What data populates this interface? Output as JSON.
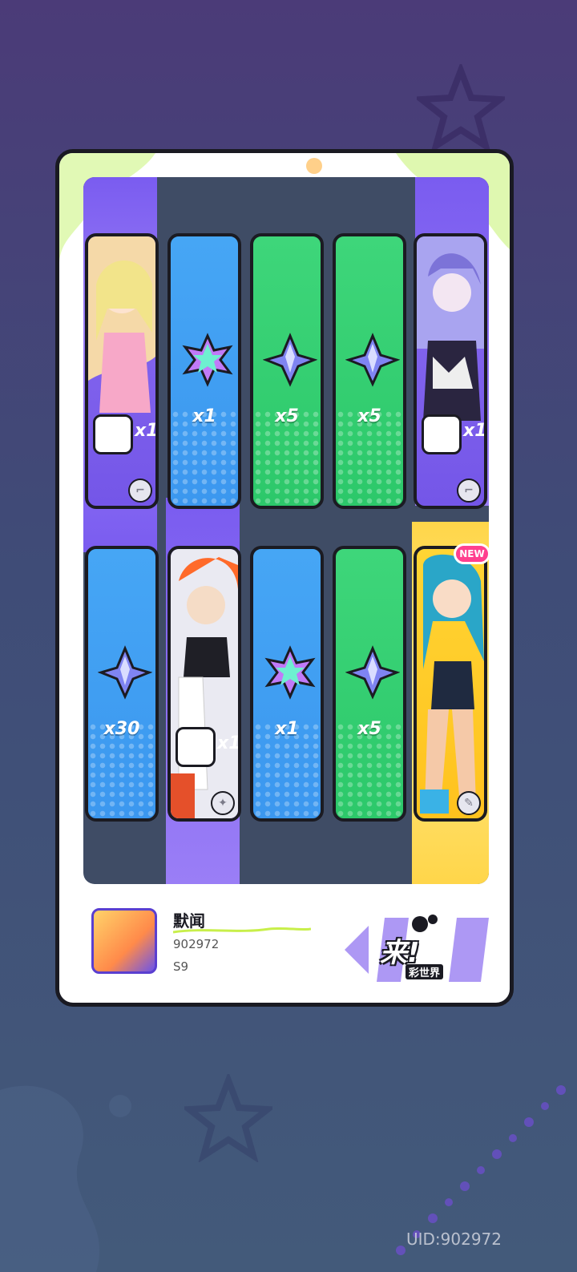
{
  "board": {
    "row1": [
      {
        "kind": "character",
        "color": "purple",
        "badge_label": "x1",
        "type_icon": "gun-icon"
      },
      {
        "kind": "item",
        "color": "blue",
        "gem": "rainbow-leaf-gem-icon",
        "qty": "x1"
      },
      {
        "kind": "item",
        "color": "green",
        "gem": "blue-star-gem-icon",
        "qty": "x5"
      },
      {
        "kind": "item",
        "color": "green",
        "gem": "blue-star-gem-icon",
        "qty": "x5"
      },
      {
        "kind": "character",
        "color": "purple",
        "badge_label": "x1",
        "type_icon": "gun-icon"
      }
    ],
    "row2": [
      {
        "kind": "item",
        "color": "blue",
        "gem": "blue-star-gem-icon",
        "qty": "x30"
      },
      {
        "kind": "character",
        "color": "purple",
        "badge_label": "x1",
        "type_icon": "sword-icon"
      },
      {
        "kind": "item",
        "color": "blue",
        "gem": "rainbow-leaf-gem-icon",
        "qty": "x1"
      },
      {
        "kind": "item",
        "color": "green",
        "gem": "blue-star-gem-icon",
        "qty": "x5"
      },
      {
        "kind": "character",
        "color": "gold",
        "new_label": "NEW",
        "type_icon": "brush-icon"
      }
    ]
  },
  "player": {
    "name": "默闻",
    "id": "902972",
    "season": "S9"
  },
  "logo": {
    "main": "来!",
    "sub": "彩世界"
  },
  "uid_text": "UID:902972",
  "colors": {
    "purple_tile": "#7456e8",
    "blue_tile": "#3b97ef",
    "green_tile": "#2cc86a",
    "gold_tile": "#ffc21e",
    "accent_lime": "#c8ef4a"
  }
}
